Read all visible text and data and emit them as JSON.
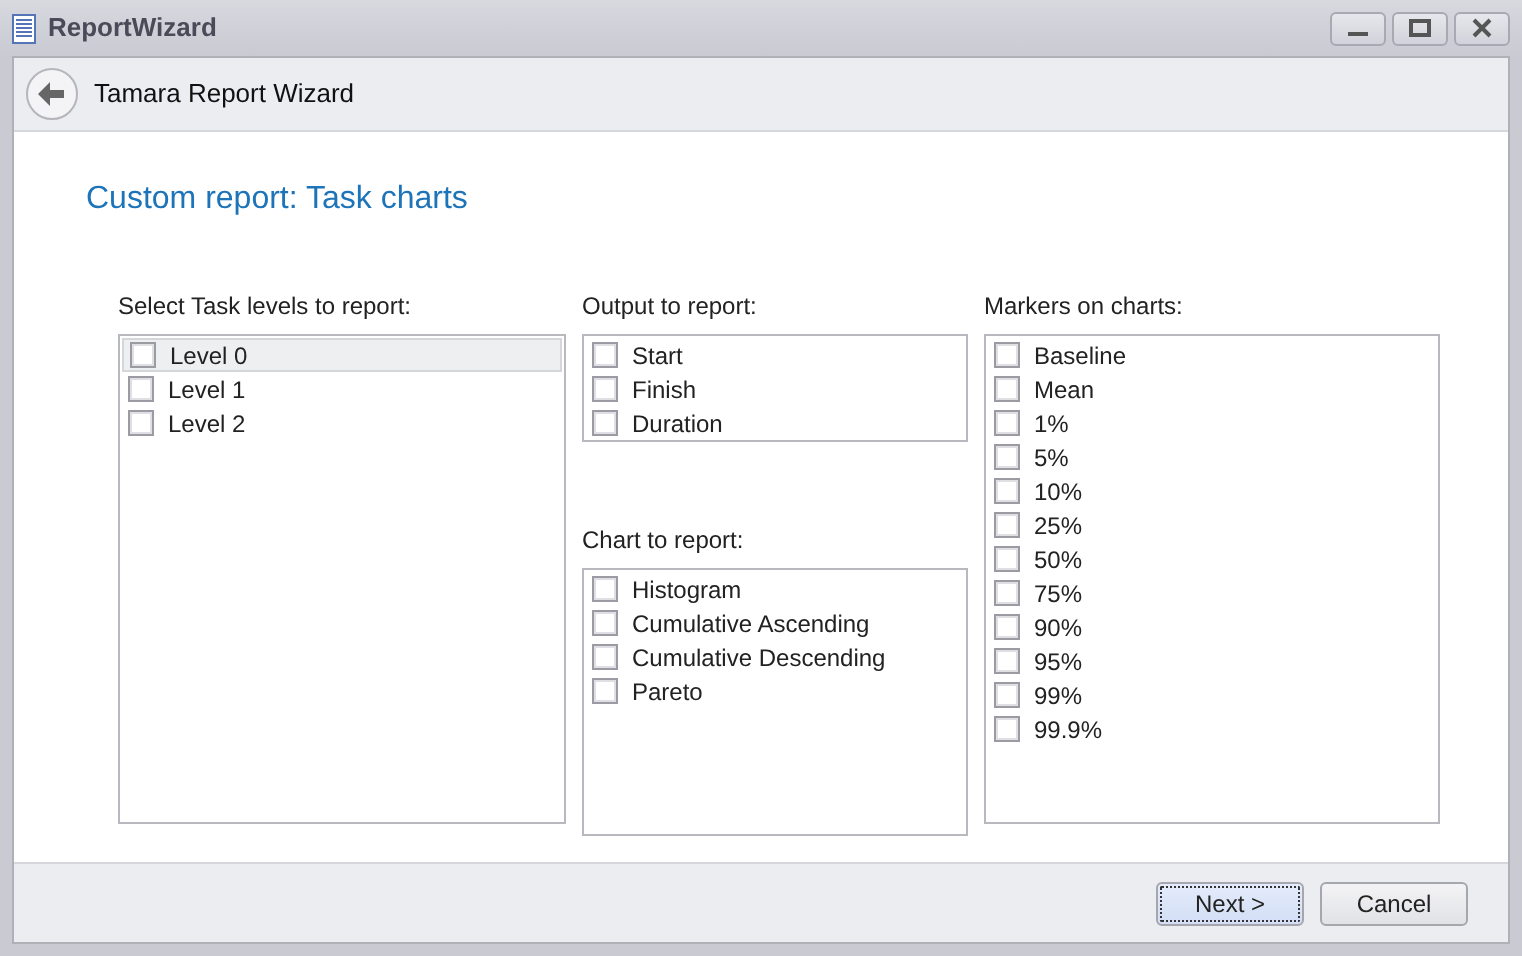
{
  "window": {
    "title": "ReportWizard"
  },
  "header": {
    "title": "Tamara Report Wizard"
  },
  "page_title": "Custom report: Task charts",
  "task_levels": {
    "label": "Select Task levels to report:",
    "items": [
      {
        "label": "Level 0",
        "checked": false,
        "selected": true
      },
      {
        "label": "Level 1",
        "checked": false,
        "selected": false
      },
      {
        "label": "Level 2",
        "checked": false,
        "selected": false
      }
    ]
  },
  "output": {
    "label": "Output to report:",
    "items": [
      {
        "label": "Start",
        "checked": false
      },
      {
        "label": "Finish",
        "checked": false
      },
      {
        "label": "Duration",
        "checked": false
      }
    ]
  },
  "chart": {
    "label": "Chart to report:",
    "items": [
      {
        "label": "Histogram",
        "checked": false
      },
      {
        "label": "Cumulative Ascending",
        "checked": false
      },
      {
        "label": "Cumulative Descending",
        "checked": false
      },
      {
        "label": "Pareto",
        "checked": false
      }
    ]
  },
  "markers": {
    "label": "Markers on charts:",
    "items": [
      {
        "label": "Baseline",
        "checked": false
      },
      {
        "label": "Mean",
        "checked": false
      },
      {
        "label": "1%",
        "checked": false
      },
      {
        "label": "5%",
        "checked": false
      },
      {
        "label": "10%",
        "checked": false
      },
      {
        "label": "25%",
        "checked": false
      },
      {
        "label": "50%",
        "checked": false
      },
      {
        "label": "75%",
        "checked": false
      },
      {
        "label": "90%",
        "checked": false
      },
      {
        "label": "95%",
        "checked": false
      },
      {
        "label": "99%",
        "checked": false
      },
      {
        "label": "99.9%",
        "checked": false
      }
    ]
  },
  "buttons": [
    {
      "label": "Next >",
      "focused": true
    },
    {
      "label": "Cancel",
      "focused": false
    }
  ]
}
